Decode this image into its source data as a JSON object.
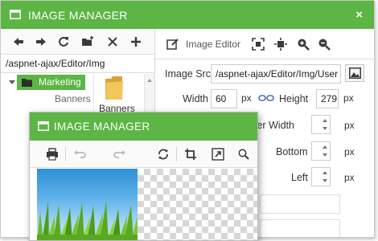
{
  "back_window": {
    "title": "IMAGE MANAGER",
    "close_glyph": "×",
    "path": "/aspnet-ajax/Editor/Img",
    "left_toolbar_icons": [
      "back-arrow-icon",
      "forward-arrow-icon",
      "refresh-icon",
      "new-folder-icon",
      "delete-icon",
      "add-icon"
    ],
    "tree": {
      "items": [
        "Marketing",
        "Banners"
      ]
    },
    "thumbnail": {
      "label": "Banners",
      "icon": "folder-icon"
    },
    "editor_toolbar": {
      "icons": [
        "image-editor-icon",
        "best-fit-icon",
        "actual-size-icon",
        "zoom-in-icon",
        "zoom-out-icon"
      ],
      "image_editor_label": "Image Editor"
    },
    "properties": {
      "image_src_label": "Image Src",
      "image_src_value": "/aspnet-ajax/Editor/Img/User",
      "width_label": "Width",
      "width_value": "60",
      "height_label": "Height",
      "height_value": "279",
      "unit": "px",
      "border_width_label": "Border Width",
      "bottom_label": "Bottom",
      "left_label": "Left"
    }
  },
  "front_window": {
    "title": "IMAGE MANAGER",
    "toolbar_icons": [
      "print-icon",
      "undo-icon",
      "redo-icon",
      "reset-icon",
      "crop-icon",
      "resize-icon",
      "zoom-icon"
    ]
  },
  "colors": {
    "titlebar": "#5cb544",
    "selected_node": "#5cb544",
    "toolbar_icon": "#3a3a3a"
  }
}
